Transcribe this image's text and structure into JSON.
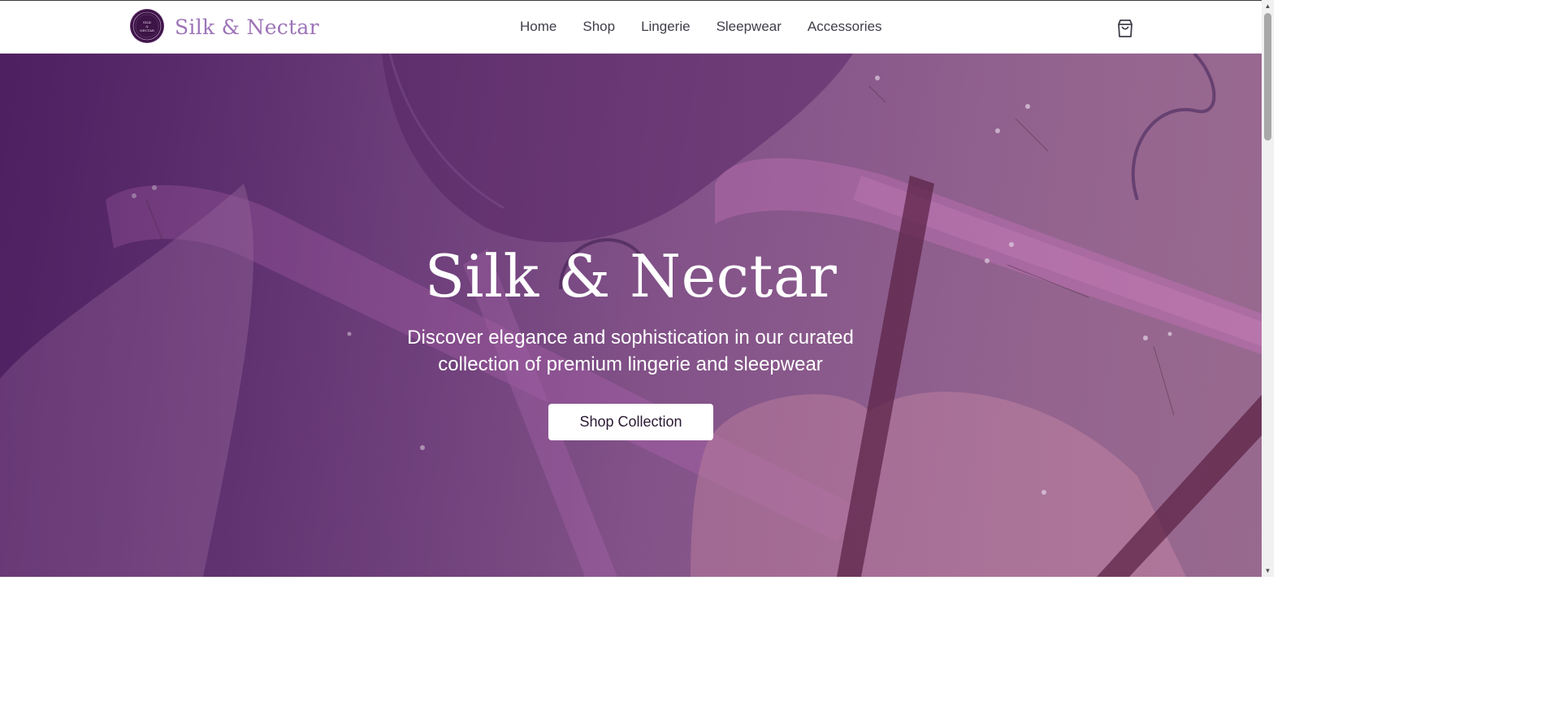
{
  "brand": {
    "name": "Silk & Nectar",
    "badge_lines": [
      "SILK",
      "&",
      "NECTAR"
    ]
  },
  "nav": {
    "items": [
      "Home",
      "Shop",
      "Lingerie",
      "Sleepwear",
      "Accessories"
    ]
  },
  "hero": {
    "title": "Silk & Nectar",
    "subtitle": "Discover elegance and sophistication in our curated collection of premium lingerie and sleepwear",
    "cta_label": "Shop Collection"
  },
  "icons": {
    "cart": "shopping-bag-icon"
  },
  "colors": {
    "brand": "#9d73b8",
    "hero_tint": "#6e3a7c",
    "badge": "#3d1446"
  }
}
